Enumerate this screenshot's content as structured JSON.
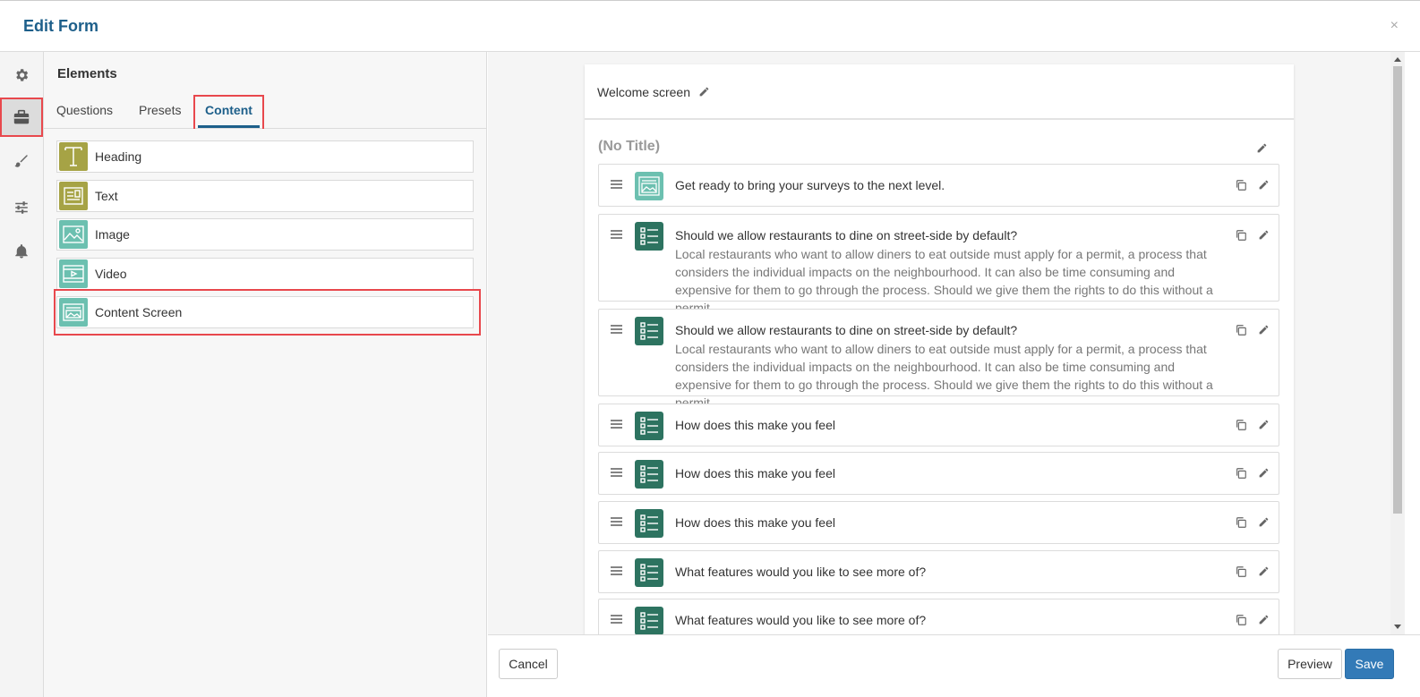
{
  "header": {
    "title": "Edit Form",
    "close_symbol": "×"
  },
  "rail": {
    "items": [
      {
        "icon": "gear-icon",
        "active": false
      },
      {
        "icon": "briefcase-icon",
        "active": true
      },
      {
        "icon": "brush-icon",
        "active": false
      },
      {
        "icon": "sliders-icon",
        "active": false
      },
      {
        "icon": "bell-icon",
        "active": false
      }
    ]
  },
  "elements": {
    "title": "Elements",
    "tabs": [
      {
        "label": "Questions"
      },
      {
        "label": "Presets"
      },
      {
        "label": "Content",
        "active": true
      }
    ],
    "items": [
      {
        "label": "Heading",
        "icon": "heading-icon",
        "color": "#a6a345"
      },
      {
        "label": "Text",
        "icon": "text-block-icon",
        "color": "#a6a345"
      },
      {
        "label": "Image",
        "icon": "image-icon",
        "color": "#6cc0b0"
      },
      {
        "label": "Video",
        "icon": "video-icon",
        "color": "#6cc0b0"
      },
      {
        "label": "Content Screen",
        "icon": "content-screen-icon",
        "color": "#6cc0b0"
      }
    ]
  },
  "canvas": {
    "welcome_title": "Welcome screen",
    "page_title": "(No Title)",
    "questions": [
      {
        "text": "Get ready to bring your surveys to the next level.",
        "desc": "",
        "icon": "content-screen-icon",
        "color": "#6cc0b0"
      },
      {
        "text": "Should we allow restaurants to dine on street-side by default?",
        "desc": "Local restaurants who want to allow diners to eat outside must apply for a permit, a process that considers the individual impacts on the neighbourhood. It can also be time consuming and expensive for them to go through the process. Should we give them the rights to do this without a permit",
        "icon": "list-icon",
        "color": "#2d7360"
      },
      {
        "text": "Should we allow restaurants to dine on street-side by default?",
        "desc": "Local restaurants who want to allow diners to eat outside must apply for a permit, a process that considers the individual impacts on the neighbourhood. It can also be time consuming and expensive for them to go through the process. Should we give them the rights to do this without a permit",
        "icon": "list-icon",
        "color": "#2d7360"
      },
      {
        "text": "How does this make you feel",
        "desc": "",
        "icon": "list-icon",
        "color": "#2d7360"
      },
      {
        "text": "How does this make you feel",
        "desc": "",
        "icon": "list-icon",
        "color": "#2d7360"
      },
      {
        "text": "How does this make you feel",
        "desc": "",
        "icon": "list-icon",
        "color": "#2d7360"
      },
      {
        "text": "What features would you like to see more of?",
        "desc": "",
        "icon": "list-icon",
        "color": "#2d7360"
      },
      {
        "text": "What features would you like to see more of?",
        "desc": "",
        "icon": "list-icon",
        "color": "#2d7360"
      }
    ]
  },
  "footer": {
    "cancel": "Cancel",
    "preview": "Preview",
    "save": "Save"
  },
  "colors": {
    "accent": "#1d5f8a",
    "save": "#337ab7",
    "highlight": "#e8484d"
  }
}
